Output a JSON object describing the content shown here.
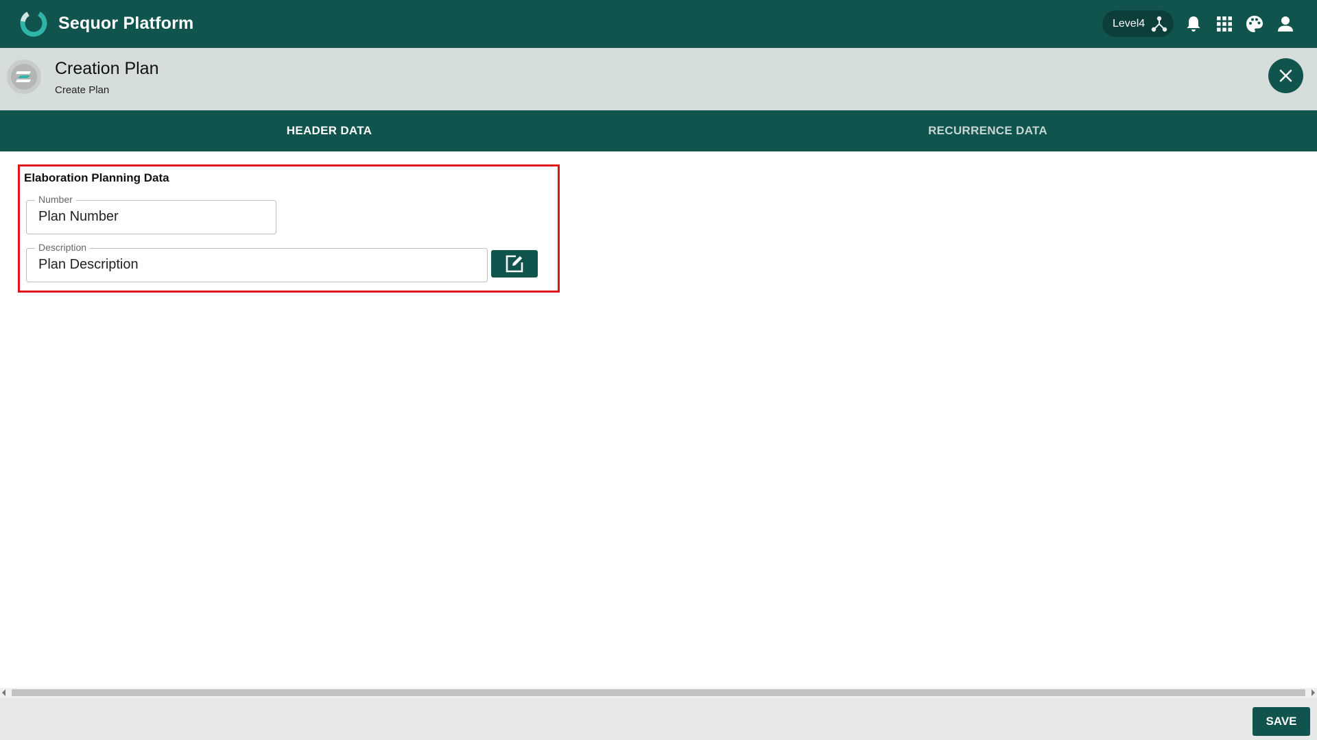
{
  "app": {
    "title": "Sequor Platform",
    "level_label": "Level4",
    "icons": [
      "brand-logo-icon",
      "hierarchy-icon",
      "bell-icon",
      "apps-grid-icon",
      "palette-icon",
      "user-icon"
    ]
  },
  "page": {
    "title": "Creation Plan",
    "subtitle": "Create Plan",
    "avatar_icon": "plan-logo-icon",
    "close_icon": "close-icon"
  },
  "tabs": [
    {
      "label": "HEADER DATA",
      "active": true
    },
    {
      "label": "RECURRENCE DATA",
      "active": false
    }
  ],
  "section": {
    "title": "Elaboration Planning Data",
    "fields": [
      {
        "label": "Number",
        "value": "Plan Number"
      },
      {
        "label": "Description",
        "value": "Plan Description"
      }
    ],
    "edit_icon": "edit-note-icon"
  },
  "footer": {
    "save_label": "SAVE"
  },
  "colors": {
    "primary": "#11544d",
    "subheader_bg": "#d5dedb",
    "highlight": "#e0121a",
    "accent": "#2fb5a8"
  }
}
